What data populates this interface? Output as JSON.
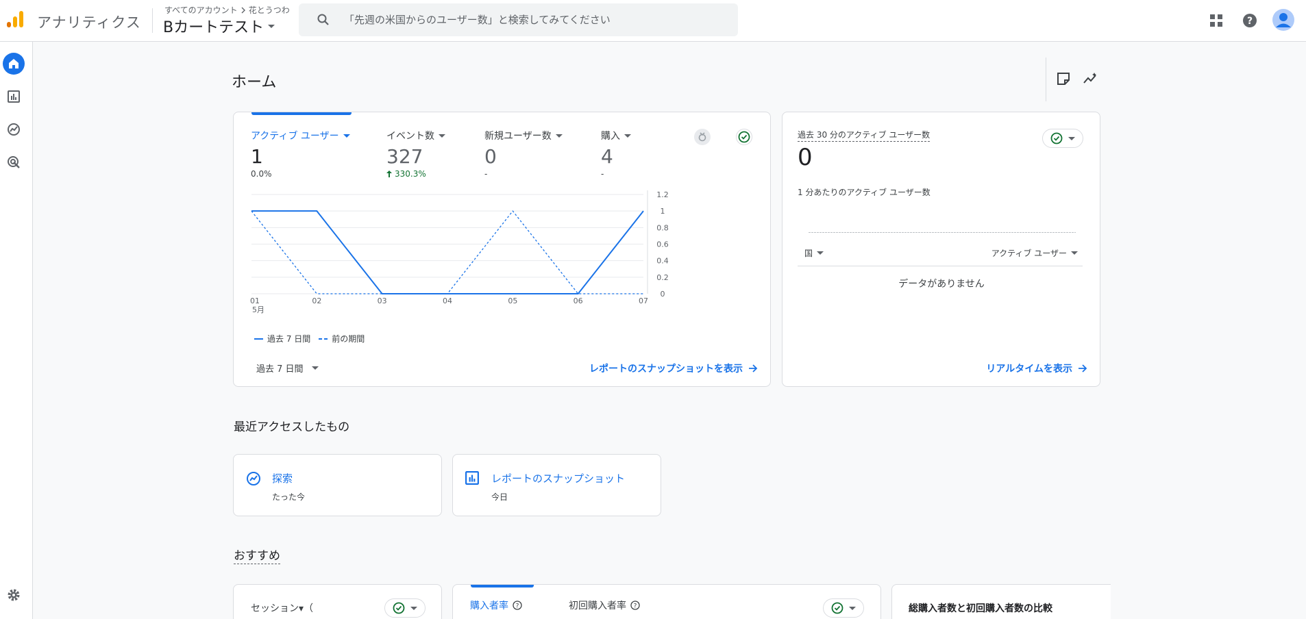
{
  "header": {
    "app_title": "アナリティクス",
    "breadcrumb_root": "すべてのアカウント",
    "breadcrumb_account": "花とうつわ",
    "property_name": "Bカートテスト",
    "search_placeholder": "「先週の米国からのユーザー数」と検索してみてください"
  },
  "colors": {
    "accent": "#1a73e8",
    "logo_orange": "#f9ab00",
    "logo_dark_orange": "#e37400",
    "positive": "#137333"
  },
  "icons": {
    "nav": [
      "home-icon",
      "reports-icon",
      "explore-icon",
      "advertising-icon",
      "settings-icon"
    ],
    "top": [
      "apps-grid-icon",
      "help-icon",
      "account-avatar-icon"
    ],
    "page": [
      "notes-icon",
      "insights-icon"
    ]
  },
  "page": {
    "title": "ホーム"
  },
  "overview": {
    "tabs": [
      {
        "label": "アクティブ ユーザー",
        "value": "1",
        "change": "0.0%"
      },
      {
        "label": "イベント数",
        "value": "327",
        "change": "330.3%"
      },
      {
        "label": "新規ユーザー数",
        "value": "0",
        "change": "-"
      },
      {
        "label": "購入",
        "value": "4",
        "change": "-"
      }
    ],
    "legend_current": "過去 7 日間",
    "legend_previous": "前の期間",
    "date_range": "過去 7 日間",
    "snapshot_link": "レポートのスナップショットを表示"
  },
  "chart_data": {
    "type": "line",
    "x": [
      "01",
      "02",
      "03",
      "04",
      "05",
      "06",
      "07"
    ],
    "x_month_label": "5月",
    "series": [
      {
        "name": "過去 7 日間",
        "style": "solid",
        "values": [
          1,
          1,
          0,
          0,
          0,
          0,
          1
        ]
      },
      {
        "name": "前の期間",
        "style": "dashed",
        "values": [
          1,
          0,
          0,
          0,
          1,
          0,
          0
        ]
      }
    ],
    "yticks": [
      "0",
      "0.2",
      "0.4",
      "0.6",
      "0.8",
      "1",
      "1.2"
    ],
    "ylim": [
      0,
      1.2
    ],
    "y_axis_position": "right",
    "grid": true,
    "legend_position": "bottom-left"
  },
  "realtime": {
    "title": "過去 30 分のアクティブ ユーザー数",
    "value": "0",
    "subtitle": "1 分あたりのアクティブ ユーザー数",
    "col_country": "国",
    "col_users": "アクティブ ユーザー",
    "empty": "データがありません",
    "link": "リアルタイムを表示"
  },
  "recent": {
    "title": "最近アクセスしたもの",
    "items": [
      {
        "name": "探索",
        "when": "たった今",
        "icon": "explore-icon"
      },
      {
        "name": "レポートのスナップショット",
        "when": "今日",
        "icon": "reports-icon"
      }
    ]
  },
  "recommended": {
    "title": "おすすめ",
    "card1_label": "セッション▾（",
    "card2_tab1": "購入者率",
    "card2_tab2": "初回購入者率",
    "card3_title": "総購入者数と初回購入者数の比較"
  }
}
